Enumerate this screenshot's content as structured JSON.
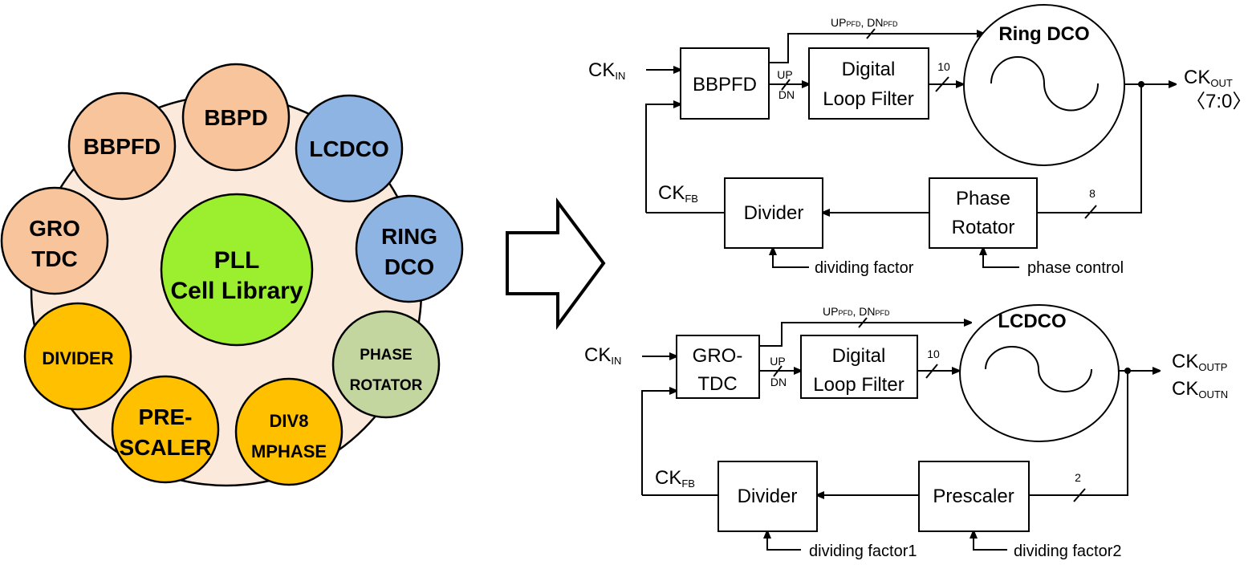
{
  "library": {
    "center": {
      "line1": "PLL",
      "line2": "Cell Library",
      "color": "#9bef2e"
    },
    "cells": [
      {
        "line1": "BBPD",
        "line2": "",
        "color": "#f8c49b"
      },
      {
        "line1": "BBPFD",
        "line2": "",
        "color": "#f8c49b"
      },
      {
        "line1": "LCDCO",
        "line2": "",
        "color": "#8eb4e3"
      },
      {
        "line1": "GRO",
        "line2": "TDC",
        "color": "#f8c49b"
      },
      {
        "line1": "RING",
        "line2": "DCO",
        "color": "#8eb4e3"
      },
      {
        "line1": "DIVIDER",
        "line2": "",
        "color": "#ffc000"
      },
      {
        "line1": "PHASE",
        "line2": "ROTATOR",
        "color": "#c4d6a0"
      },
      {
        "line1": "PRE-",
        "line2": "SCALER",
        "color": "#ffc000"
      },
      {
        "line1": "DIV8",
        "line2": "MPHASE",
        "color": "#ffc000"
      }
    ],
    "ring_color": "#fbe9dc"
  },
  "ring_pll": {
    "ck_in": {
      "main": "CK",
      "sub": "IN"
    },
    "ck_fb": {
      "main": "CK",
      "sub": "FB"
    },
    "pfd": "BBPFD",
    "up": "UP",
    "dn": "DN",
    "pfd_bus": {
      "up": "UP",
      "up_sub": "PFD",
      "sep": ", ",
      "dn": "DN",
      "dn_sub": "PFD"
    },
    "dlf_line1": "Digital",
    "dlf_line2": "Loop Filter",
    "dlf_bits": "10",
    "dco": "Ring DCO",
    "ck_out": {
      "main": "CK",
      "sub": "OUT",
      "range": "〈7:0〉"
    },
    "phase_bits": "8",
    "divider": "Divider",
    "rotator_line1": "Phase",
    "rotator_line2": "Rotator",
    "dividing_factor": "dividing factor",
    "phase_control": "phase control"
  },
  "lc_pll": {
    "ck_in": {
      "main": "CK",
      "sub": "IN"
    },
    "ck_fb": {
      "main": "CK",
      "sub": "FB"
    },
    "tdc_line1": "GRO-",
    "tdc_line2": "TDC",
    "up": "UP",
    "dn": "DN",
    "pfd_bus": {
      "up": "UP",
      "up_sub": "PFD",
      "sep": ", ",
      "dn": "DN",
      "dn_sub": "PFD"
    },
    "dlf_line1": "Digital",
    "dlf_line2": "Loop Filter",
    "dlf_bits": "10",
    "dco": "LCDCO",
    "ck_outp": {
      "main": "CK",
      "sub": "OUTP"
    },
    "ck_outn": {
      "main": "CK",
      "sub": "OUTN"
    },
    "prescaler_bits": "2",
    "divider": "Divider",
    "prescaler": "Prescaler",
    "dividing_factor1": "dividing factor1",
    "dividing_factor2": "dividing factor2"
  }
}
